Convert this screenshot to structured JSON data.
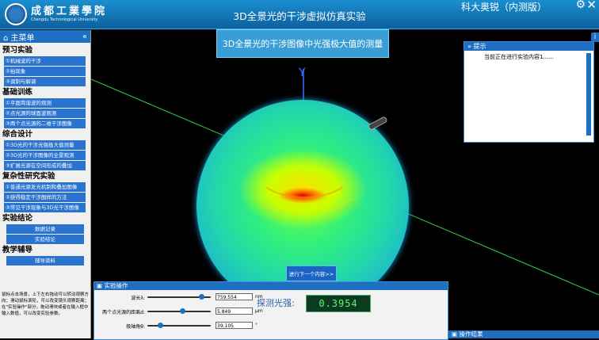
{
  "header": {
    "logo_cn": "成都工業學院",
    "logo_en": "Chengdu Technological University",
    "app_title": "3D全景光的干涉虚拟仿真实验",
    "corner_title": "科大奥锐（内测版）"
  },
  "subtitle": "3D全景光的干涉图像中光强极大值的测量",
  "sidebar": {
    "title": "主菜单",
    "collapse_glyph": "«",
    "sections": [
      {
        "title": "预习实验",
        "items": [
          "①机械波的干涉",
          "②拍现象",
          "③调制与解调"
        ]
      },
      {
        "title": "基础训练",
        "items": [
          "①平面简谐波的观测",
          "②点光源的球面波观测",
          "③两个点光源的二维干涉图像"
        ]
      },
      {
        "title": "综合设计",
        "items": [
          "①3D光的干涉光强极大值测量",
          "②3D光的干涉图像的全景观测",
          "③扩展光源在空间形成的叠加"
        ]
      },
      {
        "title": "复杂性研究实验",
        "items": [
          "①普通光源发光机制和叠加图像",
          "②获得稳定干涉图样的方法",
          "③常见干涉现象与3D光干涉图像"
        ]
      },
      {
        "title": "实验结论",
        "items": [
          "数据记录",
          "实验结论"
        ]
      },
      {
        "title": "教学辅导",
        "items": [
          "辅导资料"
        ]
      }
    ],
    "help_text": "鼠标点击场景，上下左右拖动可以转动观察方向；滑动鼠标滚轮，可以改变镜头观察距离；在\"实验操作\"部分，拖动滑块或者在输入框中输入数值，可以改变实验参数。"
  },
  "scene": {
    "y_axis_label": "Y"
  },
  "tips": {
    "title": "提示",
    "body": "当前正在进行实验内容1......"
  },
  "next_button": "进行下一个内容>>",
  "experiment": {
    "title": "实验操作",
    "params": [
      {
        "label": "波长λ:",
        "value": "759.554",
        "unit": "nm",
        "level": 0.85
      },
      {
        "label": "两个点光源的距离d:",
        "value": "5.849",
        "unit": "μm",
        "level": 0.55
      },
      {
        "label": "极轴角θ:",
        "value": "39.105",
        "unit": "°",
        "level": 0.2
      }
    ],
    "intensity_label": "探测光强:",
    "intensity_value": "0.3954"
  },
  "results": {
    "title": "操作结果"
  },
  "colors": {
    "accent": "#1e6fc2",
    "lcd_text": "#53ff6a"
  }
}
